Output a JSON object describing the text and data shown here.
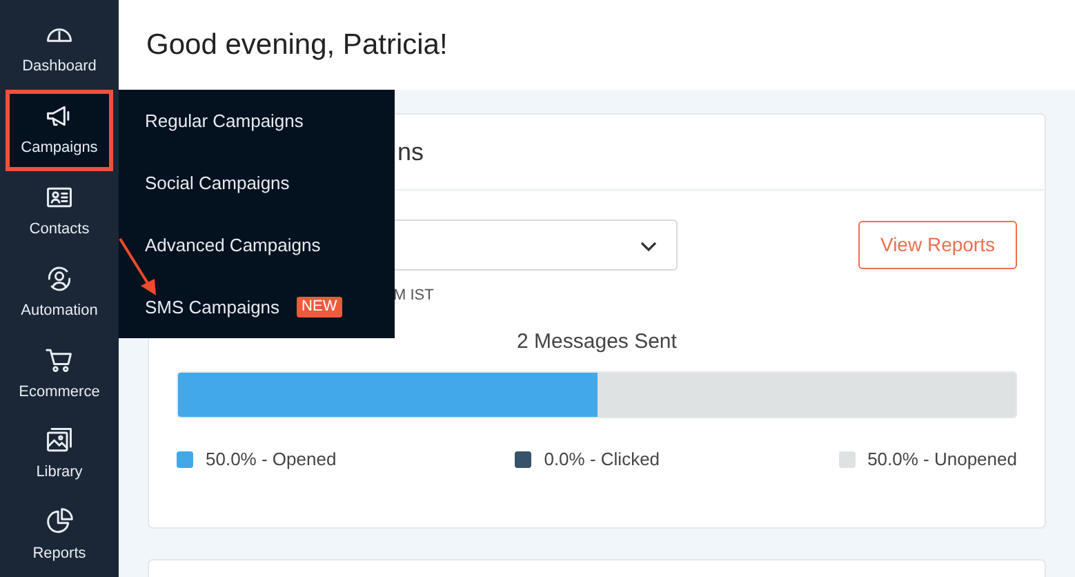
{
  "sidebar": {
    "items": [
      {
        "kind": "dashboard",
        "label": "Dashboard",
        "selected": false
      },
      {
        "kind": "campaigns",
        "label": "Campaigns",
        "selected": true
      },
      {
        "kind": "contacts",
        "label": "Contacts",
        "selected": false
      },
      {
        "kind": "automation",
        "label": "Automation",
        "selected": false
      },
      {
        "kind": "ecommerce",
        "label": "Ecommerce",
        "selected": false
      },
      {
        "kind": "library",
        "label": "Library",
        "selected": false
      },
      {
        "kind": "reports",
        "label": "Reports",
        "selected": false
      }
    ]
  },
  "flyout_menu": {
    "items": [
      {
        "label": "Regular Campaigns"
      },
      {
        "label": "Social Campaigns"
      },
      {
        "label": "Advanced Campaigns"
      },
      {
        "label": "SMS Campaigns",
        "badge": "NEW"
      }
    ]
  },
  "header": {
    "greeting": "Good evening, Patricia!"
  },
  "card": {
    "title_fragment": "ns",
    "time_fragment": "M IST",
    "button": "View Reports",
    "summary": "2 Messages Sent",
    "segments": [
      {
        "label": "50.0% - Opened",
        "color": "#42a8e8",
        "level": 0.5
      },
      {
        "label": "0.0% - Clicked",
        "color": "#37526a"
      },
      {
        "label": "50.0% - Unopened",
        "color": "#dfe2e3",
        "level": 0.5
      }
    ]
  }
}
